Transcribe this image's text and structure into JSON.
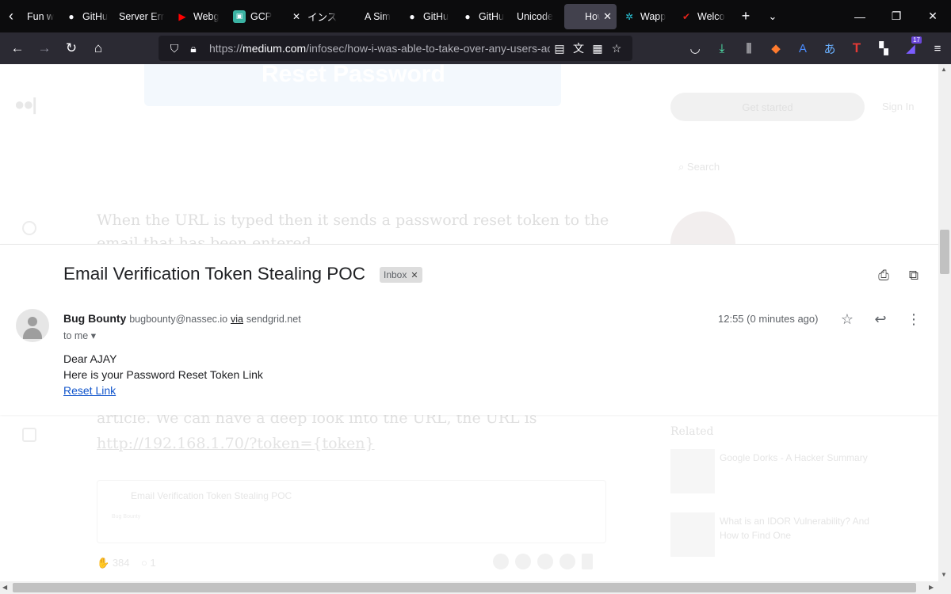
{
  "browser": {
    "tabs": [
      {
        "title": "Fun w",
        "icon": "none"
      },
      {
        "title": "GitHu",
        "icon": "github-icon"
      },
      {
        "title": "Server Erro",
        "icon": "none"
      },
      {
        "title": "Webg",
        "icon": "youtube-icon"
      },
      {
        "title": "GCP",
        "icon": "gcp-icon"
      },
      {
        "title": "インス",
        "icon": "x-icon"
      },
      {
        "title": "A Sim",
        "icon": "none"
      },
      {
        "title": "GitHu",
        "icon": "github-icon"
      },
      {
        "title": "GitHu",
        "icon": "github-icon"
      },
      {
        "title": "Unicode",
        "icon": "none"
      },
      {
        "title": "How",
        "icon": "none",
        "active": true
      },
      {
        "title": "Wapp",
        "icon": "wappalyzer-icon"
      },
      {
        "title": "Welco",
        "icon": "check-icon"
      }
    ],
    "url_prefix": "https://",
    "url_domain": "medium.com",
    "url_path": "/infosec/how-i-was-able-to-take-over-any-users-accou",
    "extension_badge": "17"
  },
  "article": {
    "header_image_text": "Reset Password",
    "get_started": "Get started",
    "sign_in": "Sign In",
    "search_placeholder": "Search",
    "paragraph1": "When the URL is typed then it sends a password reset token to the email that has been entered.",
    "paragraph2_prefix": "article. We can have a deep look into the URL, the URL is ",
    "paragraph2_link": "http://192.168.1.70/?token={token}",
    "related_heading": "Related",
    "related": [
      {
        "title": "Google Dorks - A Hacker Summary"
      },
      {
        "title": "What is an IDOR Vulnerability? And How to Find One"
      }
    ],
    "embed_subject": "Email Verification Token Stealing POC",
    "embed_sender": "Bug Bounty",
    "claps": "384",
    "responses": "1"
  },
  "email": {
    "subject": "Email Verification Token Stealing POC",
    "label": "Inbox",
    "sender_name": "Bug Bounty",
    "sender_address": "bugbounty@nassec.io",
    "via_label": "via",
    "via_domain": "sendgrid.net",
    "to": "to me",
    "time": "12:55 (0 minutes ago)",
    "greeting": "Dear AJAY",
    "line": "Here is your Password Reset Token Link",
    "link_text": "Reset Link"
  }
}
